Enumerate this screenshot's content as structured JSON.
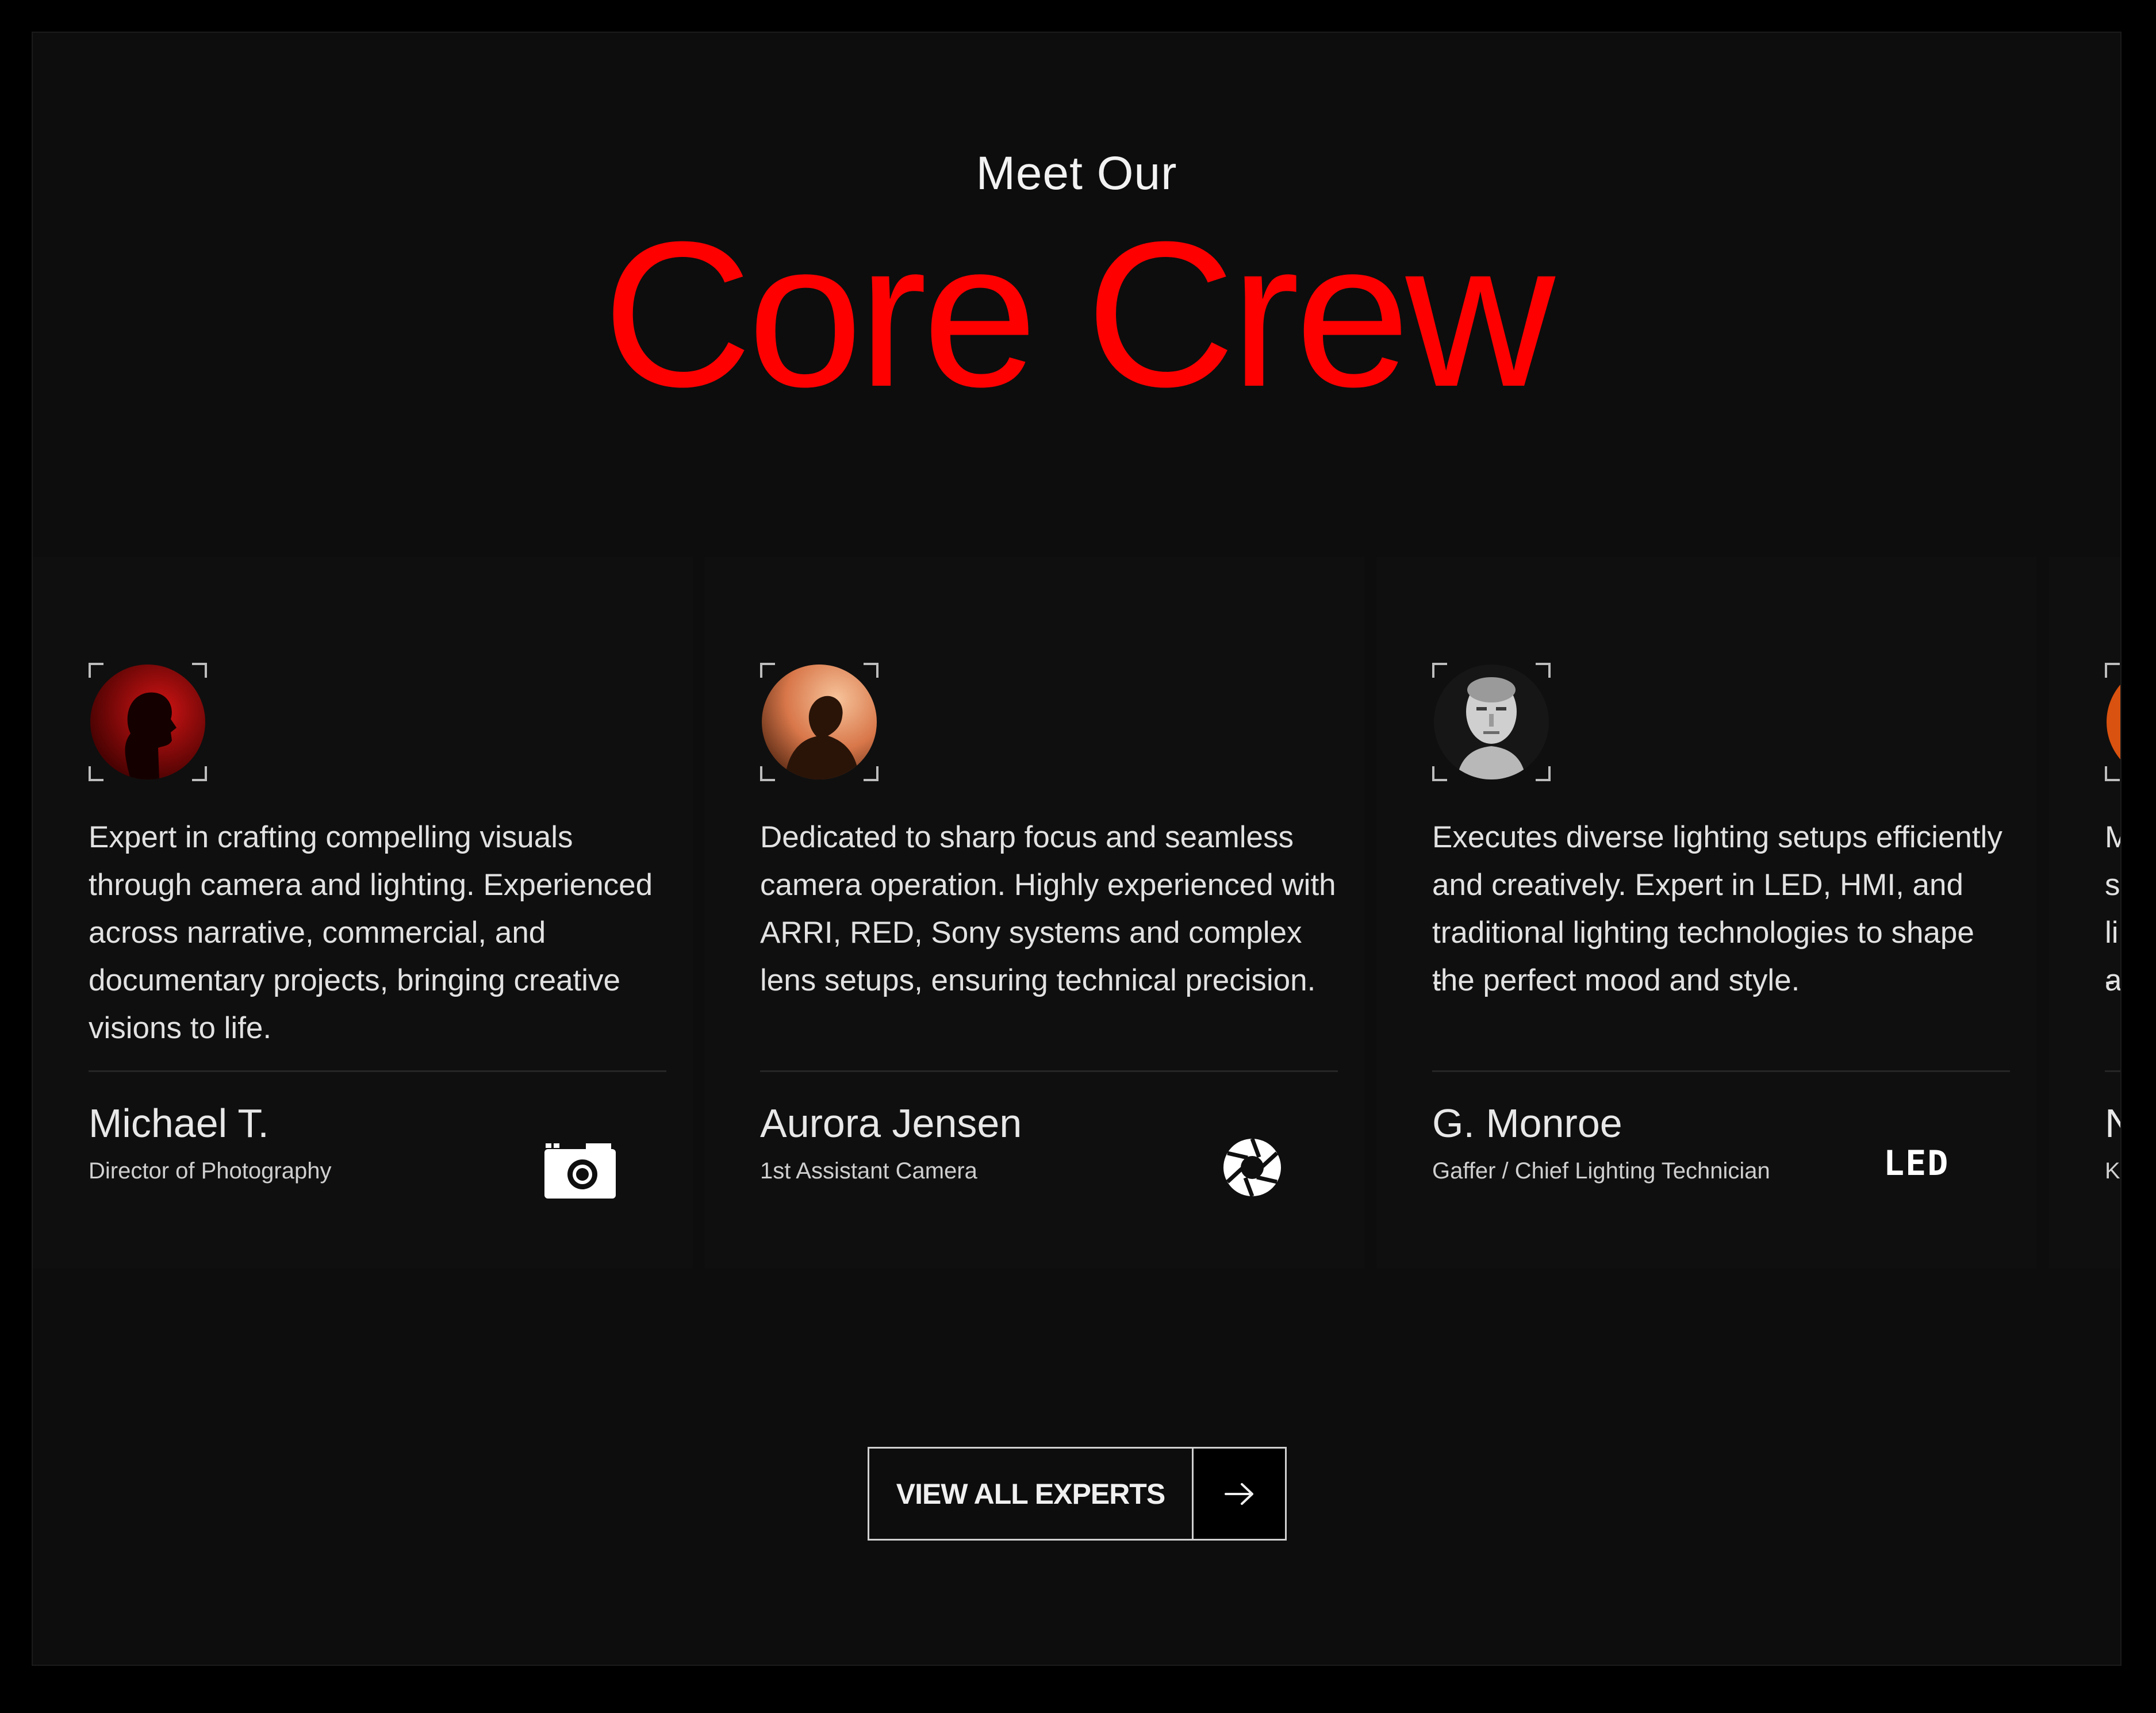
{
  "section": {
    "kicker": "Meet Our",
    "title": "Core Crew"
  },
  "colors": {
    "accent": "#ff0000",
    "background": "#0d0d0d",
    "card": "#0f0f0f",
    "text": "#e2e2e2"
  },
  "crew": [
    {
      "bio": "Expert in crafting compelling visuals through camera and lighting. Experienced across narrative, commercial, and documentary projects, bringing creative visions to life.",
      "name": "Michael T.",
      "role": "Director of Photography",
      "icon": "camera-icon",
      "avatar": "red-silhouette-avatar"
    },
    {
      "bio": "Dedicated to sharp focus and seamless camera operation. Highly experienced with ARRI, RED, Sony systems and complex lens setups, ensuring technical precision.",
      "name": "Aurora Jensen",
      "role": "1st Assistant Camera",
      "icon": "aperture-icon",
      "avatar": "orange-profile-avatar"
    },
    {
      "bio": "Executes diverse lighting setups efficiently and creatively. Expert in LED, HMI, and traditional lighting technologies to shape the perfect mood and style.",
      "bio_extra": "-",
      "name": "G. Monroe",
      "role": "Gaffer / Chief Lighting Technician",
      "icon": "led-icon",
      "icon_text": "LED",
      "avatar": "monochrome-portrait-avatar"
    },
    {
      "bio": "M s li a",
      "bio_extra": "-",
      "name": "N",
      "role": "K",
      "avatar": "orange-avatar"
    }
  ],
  "cta": {
    "label": "VIEW ALL EXPERTS",
    "icon": "arrow-right-icon"
  }
}
